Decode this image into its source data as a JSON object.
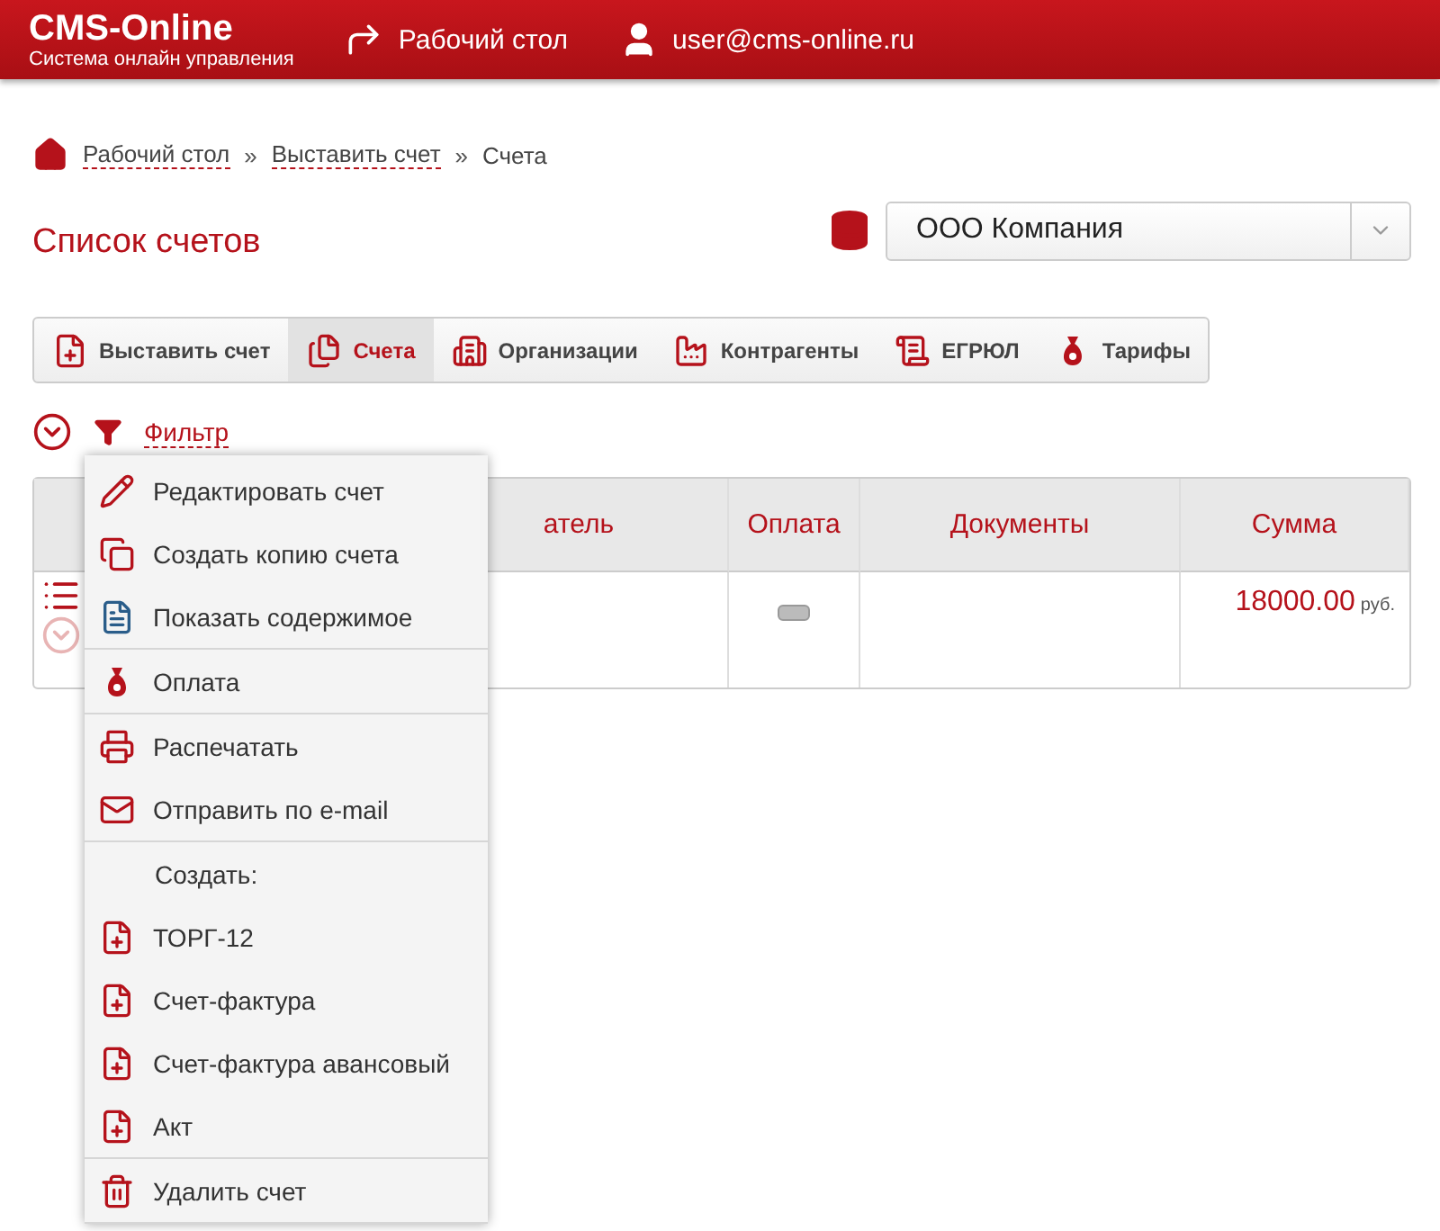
{
  "header": {
    "brand": "CMS-Online",
    "tagline": "Система онлайн управления",
    "desk_link": "Рабочий стол",
    "user": "user@cms-online.ru"
  },
  "breadcrumbs": [
    {
      "label": "Рабочий стол",
      "link": true
    },
    {
      "label": "Выставить счет",
      "link": true
    },
    {
      "label": "Счета",
      "link": false
    }
  ],
  "breadcrumb_separator": "»",
  "page_title": "Список счетов",
  "company_select": {
    "value": "ООО Компания"
  },
  "tabs": [
    {
      "label": "Выставить счет",
      "selected": false
    },
    {
      "label": "Счета",
      "selected": true
    },
    {
      "label": "Организации",
      "selected": false
    },
    {
      "label": "Контрагенты",
      "selected": false
    },
    {
      "label": "ЕГРЮЛ",
      "selected": false
    },
    {
      "label": "Тарифы",
      "selected": false
    }
  ],
  "filter": {
    "label": "Фильтр"
  },
  "table": {
    "columns": [
      "атель",
      "Оплата",
      "Документы",
      "Сумма"
    ],
    "rows": [
      {
        "paid": false,
        "amount": "18000.00",
        "currency": "руб."
      }
    ]
  },
  "context_menu": {
    "groups": [
      [
        {
          "kind": "action",
          "label": "Редактировать счет"
        },
        {
          "kind": "action",
          "label": "Создать копию счета"
        },
        {
          "kind": "action",
          "label": "Показать содержимое"
        }
      ],
      [
        {
          "kind": "action",
          "label": "Оплата"
        }
      ],
      [
        {
          "kind": "action",
          "label": "Распечатать"
        },
        {
          "kind": "action",
          "label": "Отправить по e-mail"
        }
      ],
      [
        {
          "kind": "heading",
          "label": "Создать:"
        },
        {
          "kind": "action",
          "label": "ТОРГ-12"
        },
        {
          "kind": "action",
          "label": "Счет-фактура"
        },
        {
          "kind": "action",
          "label": "Счет-фактура авансовый"
        },
        {
          "kind": "action",
          "label": "Акт"
        }
      ],
      [
        {
          "kind": "action",
          "label": "Удалить счет"
        }
      ]
    ]
  }
}
